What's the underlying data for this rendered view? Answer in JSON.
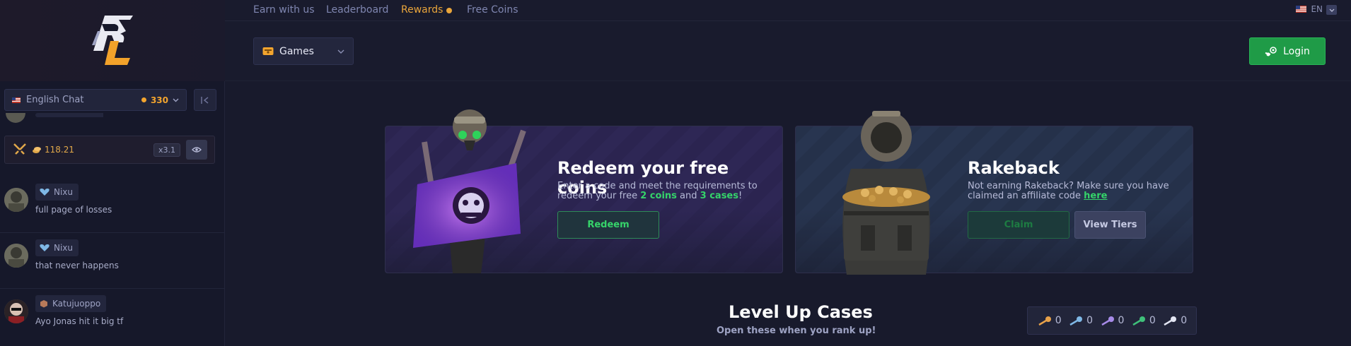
{
  "nav": {
    "links": [
      "Earn with us",
      "Leaderboard",
      "Rewards",
      "Free Coins"
    ],
    "language": "EN"
  },
  "header": {
    "games_label": "Games",
    "login_label": "Login"
  },
  "chat": {
    "room_label": "English Chat",
    "online_count": "330",
    "rain_amount": "118.21",
    "multiplier": "x3.1",
    "messages": [
      {
        "user": "Nixu",
        "text": "full page of losses"
      },
      {
        "user": "Nixu",
        "text": "that never happens"
      },
      {
        "user": "Katujuoppo",
        "text": "Ayo Jonas hit it big tf"
      }
    ]
  },
  "redeem": {
    "title": "Redeem your free coins",
    "desc_pre": "Enter a code and meet the requirements to redeem your free ",
    "coins": "2 coins",
    "and": " and ",
    "cases": "3 cases",
    "bang": "!",
    "button": "Redeem"
  },
  "rakeback": {
    "title": "Rakeback",
    "desc_pre": "Not earning Rakeback? Make sure you have claimed an affiliate code ",
    "link": "here",
    "claim_button": "Claim",
    "tiers_button": "View Tiers"
  },
  "level_up": {
    "title": "Level Up Cases",
    "subtitle": "Open these when you rank up!",
    "keys": [
      {
        "color": "#e8a24a",
        "count": "0"
      },
      {
        "color": "#7fb8e6",
        "count": "0"
      },
      {
        "color": "#a78be8",
        "count": "0"
      },
      {
        "color": "#3fc07a",
        "count": "0"
      },
      {
        "color": "#e3e6f3",
        "count": "0"
      }
    ]
  },
  "colors": {
    "accent_gold": "#e9a53b",
    "accent_green": "#1f9b47",
    "background": "#181a2b"
  }
}
